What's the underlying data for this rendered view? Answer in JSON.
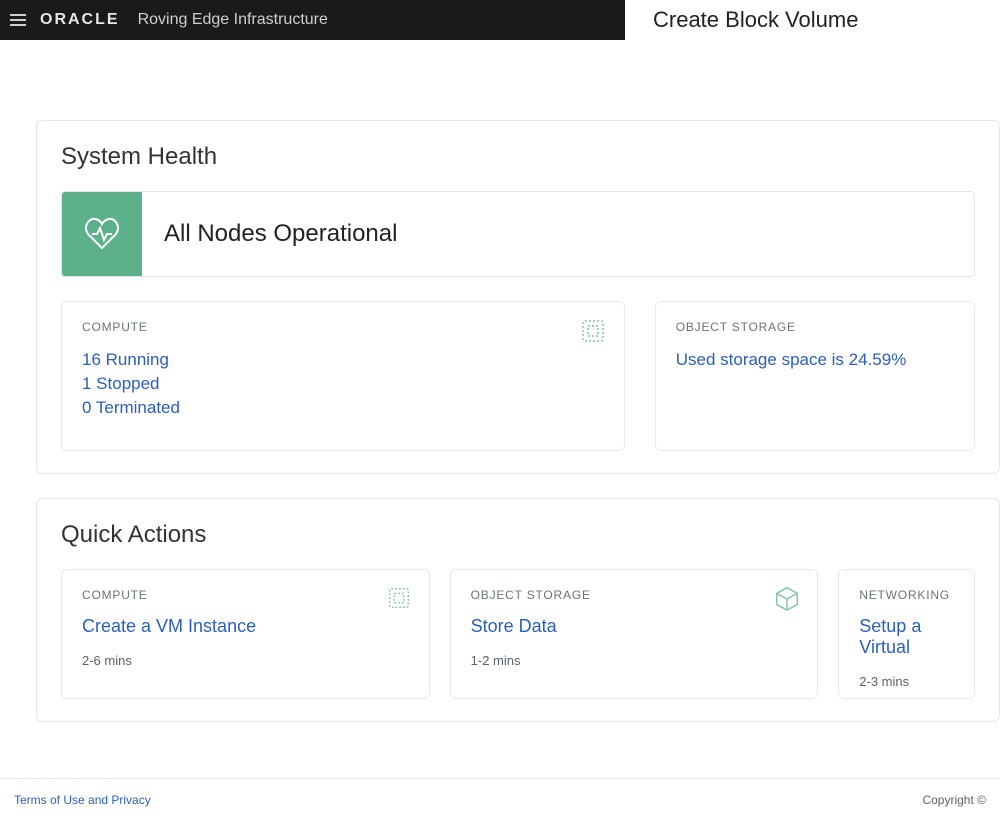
{
  "header": {
    "brand": "ORACLE",
    "product": "Roving Edge Infrastructure",
    "page_title": "Create Block Volume"
  },
  "system_health": {
    "title": "System Health",
    "status": "All Nodes Operational",
    "compute": {
      "label": "COMPUTE",
      "running": "16 Running",
      "stopped": "1 Stopped",
      "terminated": "0 Terminated"
    },
    "object_storage": {
      "label": "OBJECT STORAGE",
      "usage": "Used storage space is 24.59%"
    }
  },
  "quick_actions": {
    "title": "Quick Actions",
    "compute": {
      "label": "COMPUTE",
      "action": "Create a VM Instance",
      "time": "2-6 mins"
    },
    "storage": {
      "label": "OBJECT STORAGE",
      "action": "Store Data",
      "time": "1-2 mins"
    },
    "networking": {
      "label": "NETWORKING",
      "action": "Setup a Virtual",
      "time": "2-3 mins"
    }
  },
  "footer": {
    "terms": "Terms of Use and Privacy",
    "copyright": "Copyright ©"
  }
}
